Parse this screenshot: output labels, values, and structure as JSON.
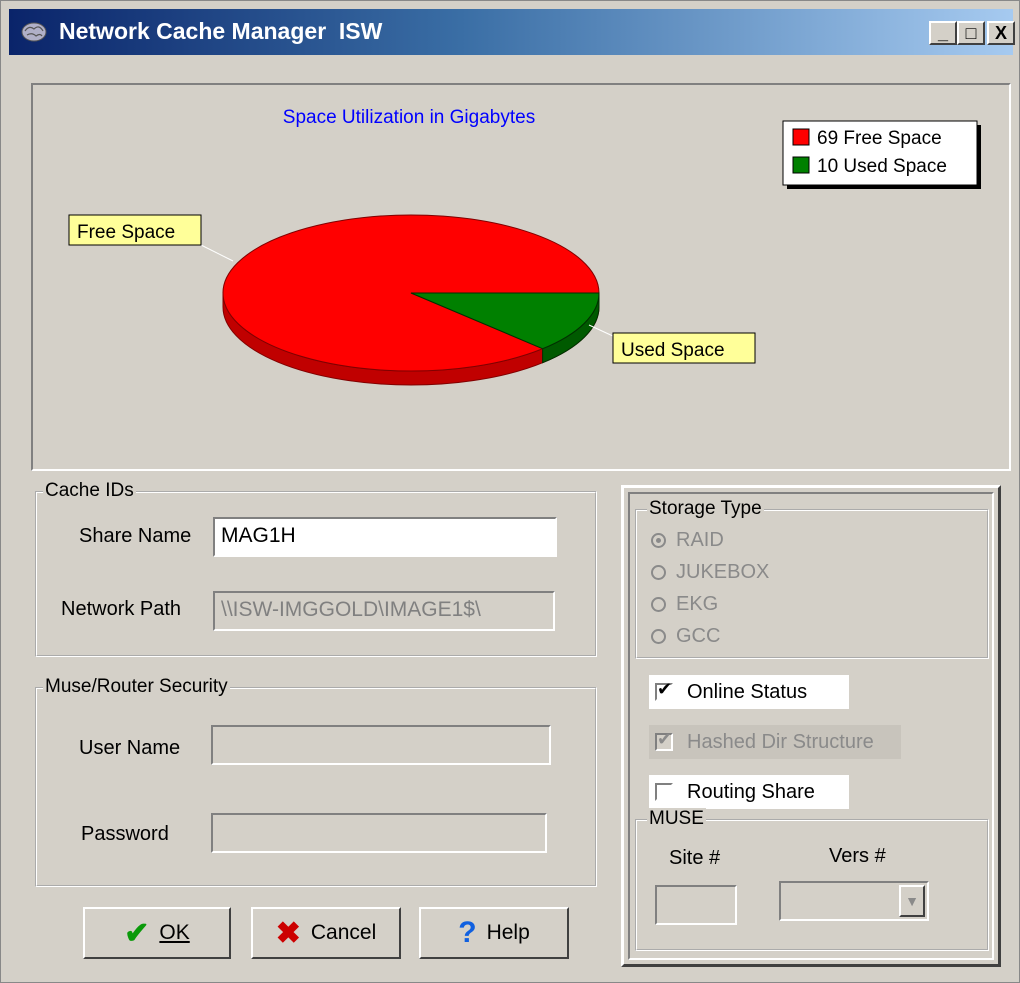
{
  "window": {
    "title": "Network Cache Manager  ISW",
    "minimize_label": "_",
    "maximize_label": "□",
    "close_label": "X"
  },
  "chart": {
    "title": "Space Utilization in Gigabytes",
    "callout_free": "Free Space",
    "callout_used": "Used Space"
  },
  "chart_data": {
    "type": "pie",
    "title": "Space Utilization in Gigabytes",
    "categories": [
      "Free Space",
      "Used Space"
    ],
    "values": [
      69,
      10
    ],
    "colors": [
      "#ff0000",
      "#008000"
    ],
    "legend": [
      "69 Free Space",
      "10 Used Space"
    ],
    "legend_position": "top-right"
  },
  "cache_ids": {
    "group_title": "Cache IDs",
    "share_name_label": "Share Name",
    "share_name_value": "MAG1H",
    "network_path_label": "Network Path",
    "network_path_value": "\\\\ISW-IMGGOLD\\IMAGE1$\\"
  },
  "security": {
    "group_title": "Muse/Router Security",
    "user_name_label": "User Name",
    "user_name_value": "",
    "password_label": "Password",
    "password_value": ""
  },
  "buttons": {
    "ok": "OK",
    "cancel": "Cancel",
    "help": "Help"
  },
  "storage": {
    "group_title": "Storage Type",
    "options": [
      "RAID",
      "JUKEBOX",
      "EKG",
      "GCC"
    ],
    "selected": "RAID"
  },
  "checks": {
    "online_status": "Online Status",
    "hashed_dir": "Hashed Dir Structure",
    "routing_share": "Routing Share"
  },
  "muse": {
    "group_title": "MUSE",
    "site_label": "Site #",
    "vers_label": "Vers #",
    "site_value": "",
    "vers_value": ""
  },
  "colors": {
    "free": "#ff0000",
    "used": "#008000",
    "callout_bg": "#ffff99",
    "chart_title": "#0000ff"
  }
}
